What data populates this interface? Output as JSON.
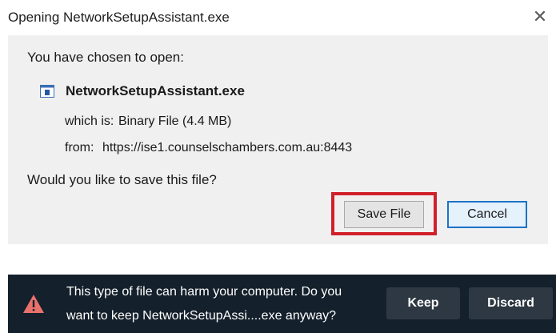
{
  "dialog": {
    "title": "Opening NetworkSetupAssistant.exe",
    "close_glyph": "✕",
    "prompt": "You have chosen to open:",
    "file": {
      "icon": "exe-file-icon",
      "name": "NetworkSetupAssistant.exe",
      "which_label": "which is:",
      "which_value": "Binary File (4.4 MB)",
      "from_label": "from:",
      "from_value": "https://ise1.counselschambers.com.au:8443"
    },
    "question": "Would you like to save this file?",
    "buttons": {
      "save": "Save File",
      "cancel": "Cancel"
    },
    "highlight_color": "#d0202a"
  },
  "warning_bar": {
    "icon": "warning-triangle-icon",
    "icon_color": "#e8716c",
    "background": "#14202b",
    "message_line1": "This type of file can harm your computer. Do you",
    "message_line2": "want to keep NetworkSetupAssi....exe anyway?",
    "buttons": {
      "keep": "Keep",
      "discard": "Discard"
    }
  }
}
